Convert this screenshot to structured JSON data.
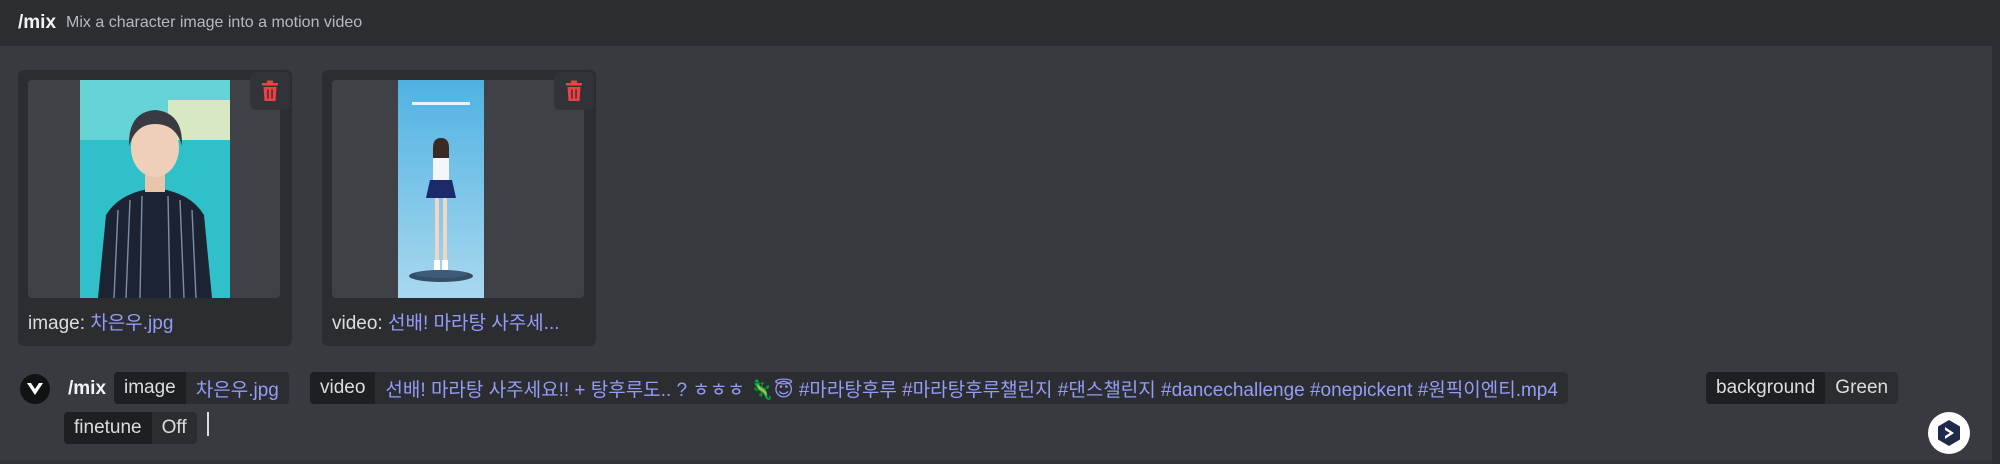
{
  "header": {
    "command": "/mix",
    "description": "Mix a character image into a motion video"
  },
  "attachments": [
    {
      "key": "image:",
      "value": "차은우.jpg",
      "delete_icon": "trash-icon"
    },
    {
      "key": "video:",
      "value": "선배! 마라탕 사주세..."
    }
  ],
  "composer": {
    "command": "/mix",
    "options": [
      {
        "key": "image",
        "value": "차은우.jpg"
      },
      {
        "key": "video",
        "value": "선배! 마라탕 사주세요!! + 탕후루도.. ? ㅎㅎㅎ 🦎😇 #마라탕후루 #마라탕후루챌린지 #댄스챌린지 #dancechallenge #onepickent #원픽이엔티.mp4"
      },
      {
        "key": "background",
        "value": "Green"
      },
      {
        "key": "finetune",
        "value": "Off"
      }
    ]
  },
  "colors": {
    "accent": "#949cf7",
    "danger": "#f23f42",
    "background": "#313338",
    "panel": "#383a40"
  }
}
